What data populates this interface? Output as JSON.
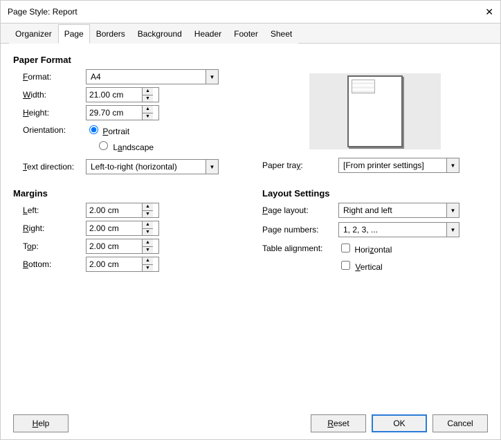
{
  "title": "Page Style: Report",
  "tabs": [
    "Organizer",
    "Page",
    "Borders",
    "Background",
    "Header",
    "Footer",
    "Sheet"
  ],
  "activeTab": 1,
  "sections": {
    "paperFormat": "Paper Format",
    "margins": "Margins",
    "layoutSettings": "Layout Settings"
  },
  "labels": {
    "format": "Format:",
    "width": "Width:",
    "height": "Height:",
    "orientation": "Orientation:",
    "textDirection": "Text direction:",
    "paperTray": "Paper tray:",
    "left": "Left:",
    "right": "Right:",
    "top": "Top:",
    "bottom": "Bottom:",
    "pageLayout": "Page layout:",
    "pageNumbers": "Page numbers:",
    "tableAlignment": "Table alignment:"
  },
  "values": {
    "format": "A4",
    "width": "21.00 cm",
    "height": "29.70 cm",
    "portrait": "Portrait",
    "landscape": "Landscape",
    "orientationSelected": "portrait",
    "textDirection": "Left-to-right (horizontal)",
    "paperTray": "[From printer settings]",
    "left": "2.00 cm",
    "right": "2.00 cm",
    "top": "2.00 cm",
    "bottom": "2.00 cm",
    "pageLayout": "Right and left",
    "pageNumbers": "1, 2, 3, ...",
    "horizontal": "Horizontal",
    "vertical": "Vertical"
  },
  "buttons": {
    "help": "Help",
    "reset": "Reset",
    "ok": "OK",
    "cancel": "Cancel"
  }
}
